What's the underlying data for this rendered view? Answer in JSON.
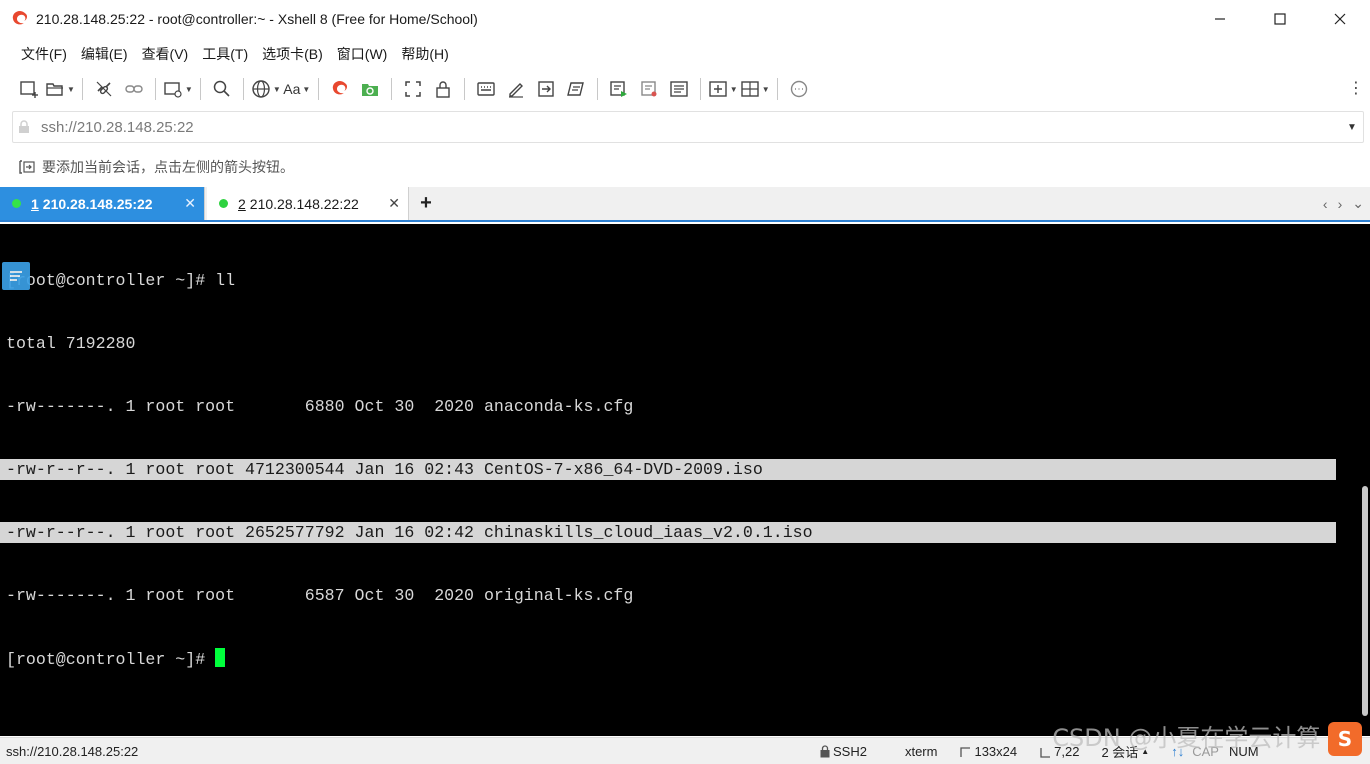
{
  "window": {
    "title": "210.28.148.25:22 - root@controller:~ - Xshell 8 (Free for Home/School)",
    "controls": {
      "minimize": "—",
      "maximize": "☐",
      "close": "✕"
    }
  },
  "menu": {
    "items": [
      "文件(F)",
      "编辑(E)",
      "查看(V)",
      "工具(T)",
      "选项卡(B)",
      "窗口(W)",
      "帮助(H)"
    ]
  },
  "toolbar": {
    "font_label": "Aa",
    "icons": [
      "new-session-icon",
      "open-folder-icon",
      "disconnect-icon",
      "reconnect-icon",
      "new-window-icon",
      "find-icon",
      "globe-icon",
      "font-icon",
      "xshell-icon",
      "xftp-icon",
      "fullscreen-icon",
      "lock-icon",
      "keyboard-icon",
      "compose-icon",
      "transfer-icon",
      "script-icon",
      "run-script-icon",
      "log-icon",
      "highlight-icon",
      "add-tab-icon",
      "layout-icon",
      "chat-icon",
      "more-icon"
    ]
  },
  "address": {
    "value": "ssh://210.28.148.25:22",
    "placeholder": "ssh://210.28.148.25:22"
  },
  "hint": {
    "text": "要添加当前会话，点击左侧的箭头按钮。"
  },
  "tabs": [
    {
      "number": "1",
      "label": "210.28.148.25:22",
      "active": true,
      "status_color": "#35e34a"
    },
    {
      "number": "2",
      "label": "210.28.148.22:22",
      "active": false,
      "status_color": "#2fd240"
    }
  ],
  "tab_nav": {
    "prev": "‹",
    "next": "›",
    "menu": "⌄"
  },
  "terminal": {
    "lines": [
      "[root@controller ~]# ll",
      "total 7192280",
      "-rw-------. 1 root root       6880 Oct 30  2020 anaconda-ks.cfg",
      "-rw-r--r--. 1 root root 4712300544 Jan 16 02:43 CentOS-7-x86_64-DVD-2009.iso",
      "-rw-r--r--. 1 root root 2652577792 Jan 16 02:42 chinaskills_cloud_iaas_v2.0.1.iso",
      "-rw-------. 1 root root       6587 Oct 30  2020 original-ks.cfg"
    ],
    "prompt": "[root@controller ~]# ",
    "selected_lines": [
      3,
      4
    ],
    "cursor_color": "#00ff3c"
  },
  "status": {
    "connection": "ssh://210.28.148.25:22",
    "protocol": "SSH2",
    "terminal_type": "xterm",
    "size": "133x24",
    "cursor_pos": "7,22",
    "sessions": "2 会话",
    "caps": "CAP",
    "num": "NUM"
  },
  "watermark": {
    "text": "CSDN @小夏在学云计算",
    "badge": "S"
  }
}
